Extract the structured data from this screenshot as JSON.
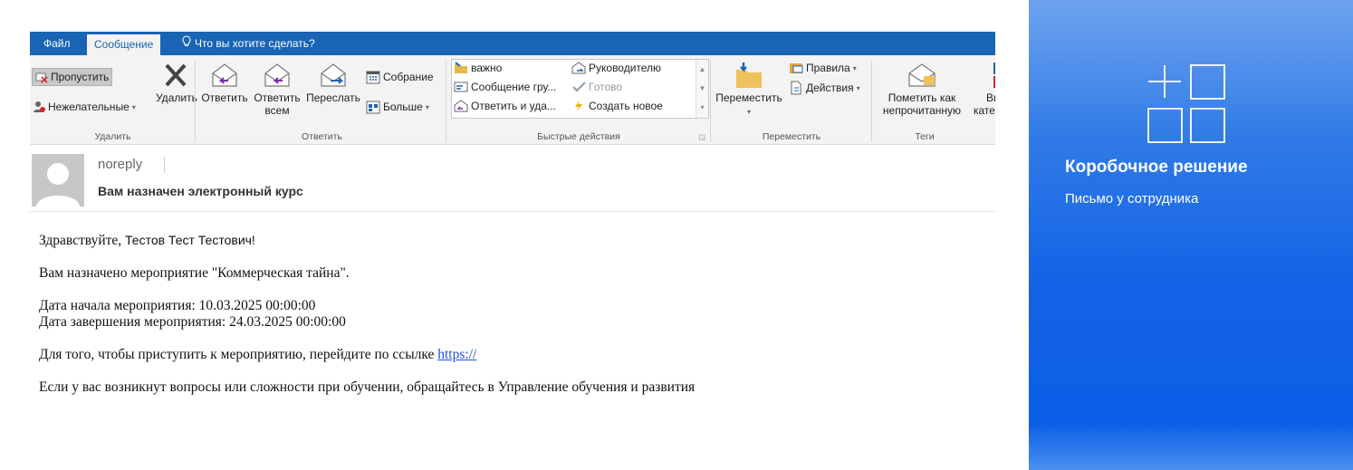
{
  "tabs": {
    "file": "Файл",
    "message": "Сообщение",
    "tell_me": "Что вы хотите сделать?"
  },
  "ribbon": {
    "delete_group": {
      "ignore": "Пропустить",
      "junk": "Нежелательные",
      "delete": "Удалить",
      "label": "Удалить"
    },
    "respond_group": {
      "reply": "Ответить",
      "reply_all_line1": "Ответить",
      "reply_all_line2": "всем",
      "forward": "Переслать",
      "meeting": "Собрание",
      "more": "Больше",
      "label": "Ответить"
    },
    "quick_steps": {
      "items": [
        "важно",
        "Руководителю",
        "Сообщение гру...",
        "Готово",
        "Ответить и уда...",
        "Создать новое"
      ],
      "label": "Быстрые действия"
    },
    "move_group": {
      "move": "Переместить",
      "rules": "Правила",
      "actions": "Действия",
      "label": "Переместить"
    },
    "tags_group": {
      "mark_unread_line1": "Пометить как",
      "mark_unread_line2": "непрочитанную",
      "categorize_partial": "Вы",
      "categorize_partial2": "катег",
      "label": "Теги"
    }
  },
  "message": {
    "sender": "noreply",
    "subject": "Вам назначен электронный курс",
    "greeting_prefix": "Здравствуйте, ",
    "greeting_name": "Тестов Тест Тестович!",
    "line_assigned": "Вам назначено мероприятие \"Коммерческая тайна\".",
    "line_start": "Дата начала мероприятия: 10.03.2025 00:00:00",
    "line_end": "Дата завершения мероприятия: 24.03.2025 00:00:00",
    "line_link_text": "Для того, чтобы приступить к мероприятию, перейдите по ссылке ",
    "link": "https://",
    "line_questions": "Если у вас возникнут вопросы или сложности при обучении, обращайтесь в Управление обучения и развития"
  },
  "panel": {
    "title": "Коробочное решение",
    "subtitle": "Письмо у сотрудника",
    "background_color": "#1463e6"
  }
}
